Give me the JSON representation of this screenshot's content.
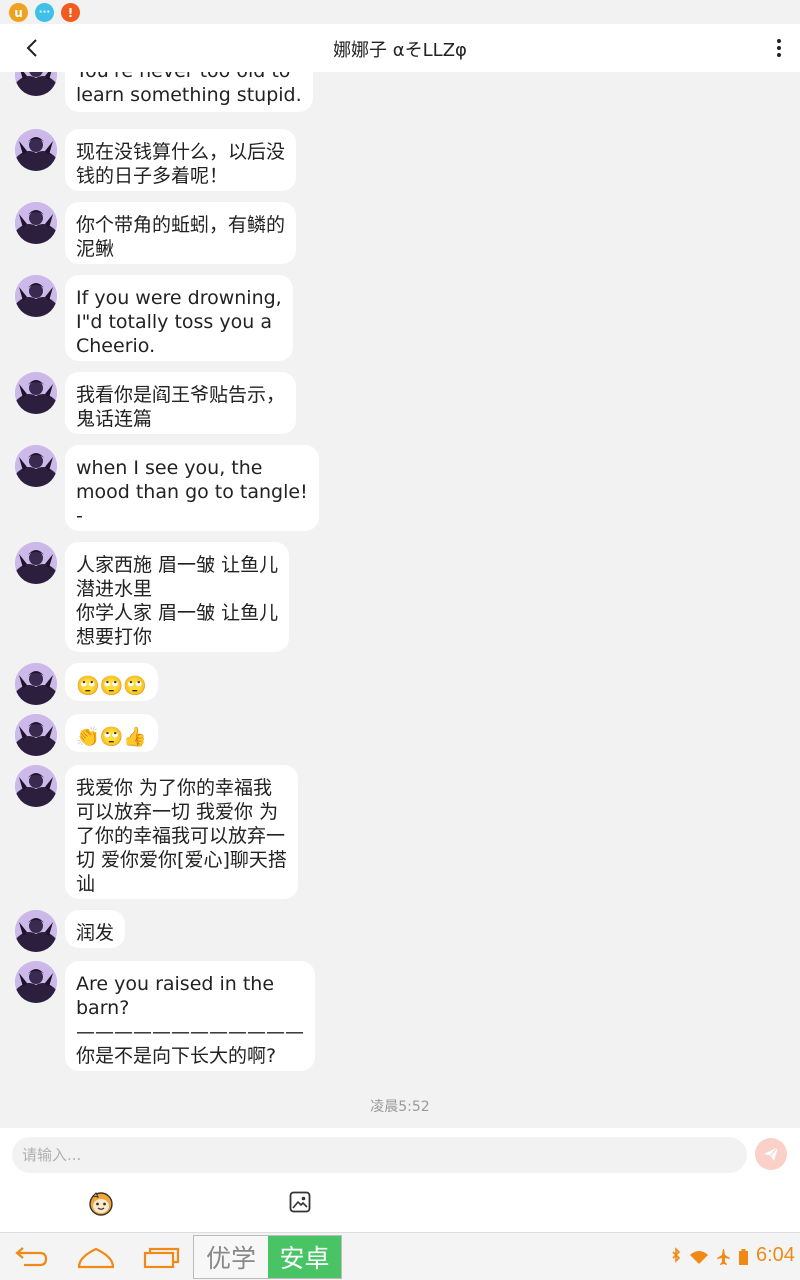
{
  "title": "娜娜子 αそLLZφ",
  "messages": [
    {
      "text": "You're never too old to\nlearn something stupid."
    },
    {
      "text": "现在没钱算什么，以后没\n钱的日子多着呢！"
    },
    {
      "text": "你个带角的蚯蚓，有鳞的\n泥鳅"
    },
    {
      "text": "If you were drowning,\nI\"d totally toss you a\nCheerio."
    },
    {
      "text": "我看你是阎王爷贴告示，\n鬼话连篇"
    },
    {
      "text": "when I see you, the\nmood than go to tangle!\n-"
    },
    {
      "text": "人家西施 眉一皱 让鱼儿\n潜进水里\n你学人家 眉一皱 让鱼儿\n想要打你"
    },
    {
      "text": "🙄🙄🙄"
    },
    {
      "text": "👏🙄👍"
    },
    {
      "text": "我爱你 为了你的幸福我\n可以放弃一切 我爱你 为\n了你的幸福我可以放弃一\n切 爱你爱你[爱心]聊天搭\n讪"
    },
    {
      "text": "润发"
    },
    {
      "text": "Are you raised in the\nbarn?\n————————————\n你是不是向下长大的啊?"
    }
  ],
  "timestamp": "凌晨5:52",
  "input": {
    "placeholder": "请输入..."
  },
  "statusbar": {
    "u_label": "u",
    "chat_label": "···",
    "warn_label": "!"
  },
  "navbar": {
    "brand_left": "优学",
    "brand_right": "安卓",
    "clock": "6:04"
  },
  "icons": {
    "back": "chevron-left-icon",
    "more": "more-vertical-icon",
    "send": "send-icon",
    "emoji": "emoji-face-icon",
    "image": "image-icon",
    "nav_back": "nav-back-icon",
    "nav_home": "nav-home-icon",
    "nav_recent": "nav-recent-icon"
  },
  "colors": {
    "accent": "#f08a15",
    "bubble": "#ffffff",
    "background": "#f2f2f2",
    "brand_green": "#48c465"
  }
}
